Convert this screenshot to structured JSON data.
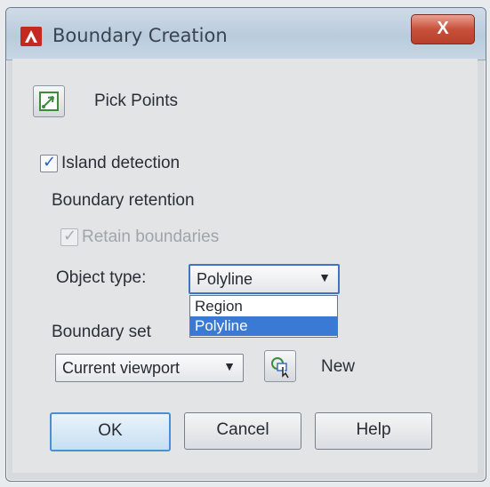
{
  "window": {
    "title": "Boundary Creation",
    "close_label": "X"
  },
  "pick_points": {
    "label": "Pick Points"
  },
  "island_detection": {
    "label": "Island detection",
    "checked": true
  },
  "boundary_retention": {
    "heading": "Boundary retention",
    "retain": {
      "label": "Retain boundaries",
      "checked": true,
      "enabled": false
    },
    "object_type": {
      "label": "Object type:",
      "selected": "Polyline",
      "options": [
        "Region",
        "Polyline"
      ],
      "highlighted": "Polyline"
    }
  },
  "boundary_set": {
    "heading": "Boundary set",
    "selected": "Current viewport",
    "new_label": "New"
  },
  "buttons": {
    "ok": "OK",
    "cancel": "Cancel",
    "help": "Help"
  },
  "colors": {
    "accent": "#3a79d4",
    "close": "#c8513b",
    "default_border": "#4a8fd4"
  }
}
